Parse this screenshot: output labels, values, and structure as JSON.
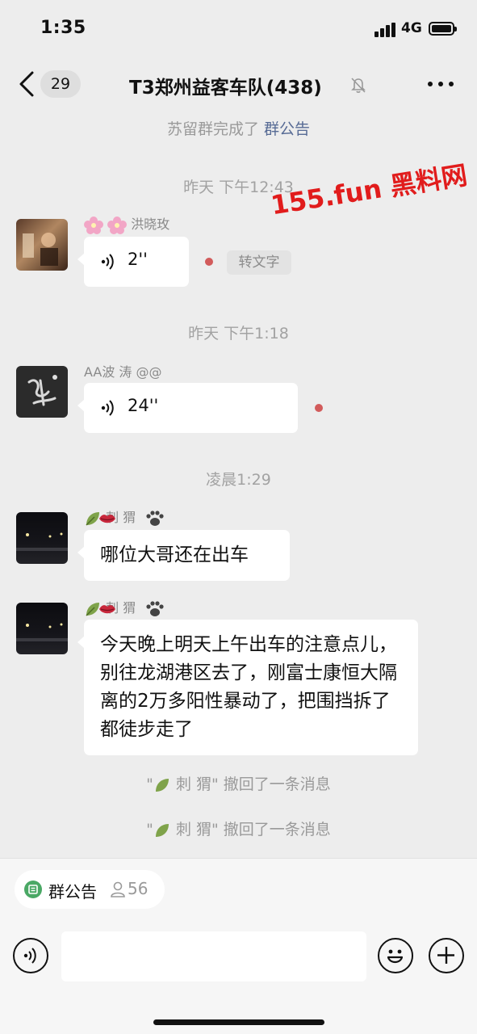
{
  "status_bar": {
    "time": "1:35",
    "network": "4G"
  },
  "header": {
    "back_count": "29",
    "title": "T3郑州益客车队(438)"
  },
  "system_notice": {
    "prefix": "苏留群完成了 ",
    "link": "群公告"
  },
  "watermark": "155.fun 黑料网",
  "messages": [
    {
      "timestamp": "昨天 下午12:43",
      "sender": "洪晓玫",
      "type": "voice",
      "duration": "2''",
      "action": "转文字"
    },
    {
      "timestamp": "昨天 下午1:18",
      "sender": "AA波 涛 @@",
      "type": "voice",
      "duration": "24''"
    },
    {
      "timestamp": "凌晨1:29",
      "sender": "刺 猬",
      "type": "text",
      "text": "哪位大哥还在出车"
    },
    {
      "sender": "刺 猬",
      "type": "text",
      "text": "今天晚上明天上午出车的注意点儿，别往龙湖港区去了，刚富士康恒大隔离的2万多阳性暴动了，把围挡拆了都徒步走了"
    }
  ],
  "recalls": [
    {
      "open_quote": "\"",
      "name": "刺 猬",
      "close_quote": "\"",
      "text": " 撤回了一条消息"
    },
    {
      "open_quote": "\"",
      "name": "刺 猬",
      "close_quote": "\"",
      "text": " 撤回了一条消息"
    }
  ],
  "bottom": {
    "notice_label": "群公告",
    "notice_count": "56",
    "input_value": ""
  },
  "icons": [
    "back-icon",
    "mute-icon",
    "more-icon",
    "voice-icon",
    "leaf-emoji",
    "lips-emoji",
    "paw-emoji",
    "notice-icon",
    "person-icon",
    "voice-mode-icon",
    "emoji-icon",
    "plus-icon"
  ],
  "colors": {
    "background": "#ededed",
    "bubble": "#ffffff",
    "link": "#576b95",
    "unread_dot": "#d25b5b",
    "watermark": "#e11c1c",
    "notice_green": "#4aa865"
  }
}
